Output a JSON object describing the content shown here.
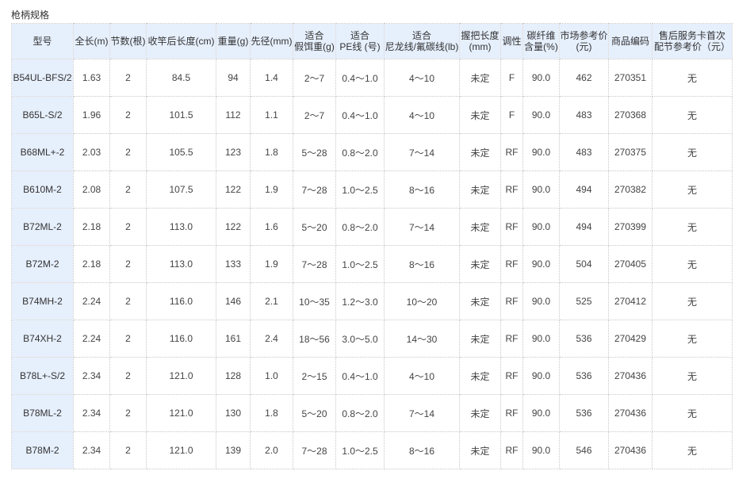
{
  "caption": "枪柄规格",
  "headers": [
    [
      "型号"
    ],
    [
      "全长(m)"
    ],
    [
      "节数(根)"
    ],
    [
      "收竿后长度(cm)"
    ],
    [
      "重量(g)"
    ],
    [
      "先径(mm)"
    ],
    [
      "适合",
      "假饵重(g)"
    ],
    [
      "适合",
      "PE线 (号)"
    ],
    [
      "适合",
      "尼龙线/氟碳线(lb)"
    ],
    [
      "握把长度",
      "(mm)"
    ],
    [
      "调性"
    ],
    [
      "碳纤维",
      "含量(%)"
    ],
    [
      "市场参考价",
      "(元)"
    ],
    [
      "商品编码"
    ],
    [
      "售后服务卡首次",
      "配节参考价（元）"
    ]
  ],
  "rows": [
    [
      "B54UL-BFS/2",
      "1.63",
      "2",
      "84.5",
      "94",
      "1.4",
      "2～7",
      "0.4～1.0",
      "4～10",
      "未定",
      "F",
      "90.0",
      "462",
      "270351",
      "无"
    ],
    [
      "B65L-S/2",
      "1.96",
      "2",
      "101.5",
      "112",
      "1.1",
      "2～7",
      "0.4～1.0",
      "4～10",
      "未定",
      "F",
      "90.0",
      "483",
      "270368",
      "无"
    ],
    [
      "B68ML+-2",
      "2.03",
      "2",
      "105.5",
      "123",
      "1.8",
      "5～28",
      "0.8～2.0",
      "7～14",
      "未定",
      "RF",
      "90.0",
      "483",
      "270375",
      "无"
    ],
    [
      "B610M-2",
      "2.08",
      "2",
      "107.5",
      "122",
      "1.9",
      "7～28",
      "1.0～2.5",
      "8～16",
      "未定",
      "RF",
      "90.0",
      "494",
      "270382",
      "无"
    ],
    [
      "B72ML-2",
      "2.18",
      "2",
      "113.0",
      "122",
      "1.6",
      "5～20",
      "0.8～2.0",
      "7～14",
      "未定",
      "RF",
      "90.0",
      "494",
      "270399",
      "无"
    ],
    [
      "B72M-2",
      "2.18",
      "2",
      "113.0",
      "133",
      "1.9",
      "7～28",
      "1.0～2.5",
      "8～16",
      "未定",
      "RF",
      "90.0",
      "504",
      "270405",
      "无"
    ],
    [
      "B74MH-2",
      "2.24",
      "2",
      "116.0",
      "146",
      "2.1",
      "10～35",
      "1.2～3.0",
      "10～20",
      "未定",
      "RF",
      "90.0",
      "525",
      "270412",
      "无"
    ],
    [
      "B74XH-2",
      "2.24",
      "2",
      "116.0",
      "161",
      "2.4",
      "18～56",
      "3.0～5.0",
      "14～30",
      "未定",
      "RF",
      "90.0",
      "536",
      "270429",
      "无"
    ],
    [
      "B78L+-S/2",
      "2.34",
      "2",
      "121.0",
      "128",
      "1.0",
      "2～15",
      "0.4～1.0",
      "4～10",
      "未定",
      "RF",
      "90.0",
      "536",
      "270436",
      "无"
    ],
    [
      "B78ML-2",
      "2.34",
      "2",
      "121.0",
      "130",
      "1.8",
      "5～20",
      "0.8～2.0",
      "7～14",
      "未定",
      "RF",
      "90.0",
      "536",
      "270436",
      "无"
    ],
    [
      "B78M-2",
      "2.34",
      "2",
      "121.0",
      "139",
      "2.0",
      "7～28",
      "1.0～2.5",
      "8～16",
      "未定",
      "RF",
      "90.0",
      "546",
      "270436",
      "无"
    ]
  ]
}
